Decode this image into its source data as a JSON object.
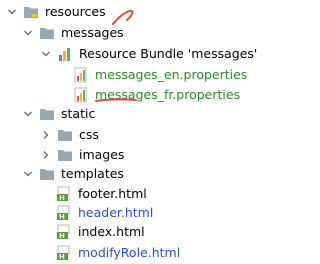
{
  "project_tree": {
    "items": [
      {
        "label": "resources",
        "icon": "folder-icon",
        "expanded": true
      },
      {
        "label": "messages",
        "icon": "folder-icon",
        "expanded": true
      },
      {
        "label": "Resource Bundle 'messages'",
        "icon": "resource-bundle-icon",
        "expanded": true
      },
      {
        "label": "messages_en.properties",
        "icon": "properties-file-icon",
        "color": "#2a8a2a"
      },
      {
        "label": "messages_fr.properties",
        "icon": "properties-file-icon",
        "color": "#2a8a2a"
      },
      {
        "label": "static",
        "icon": "folder-icon",
        "expanded": true
      },
      {
        "label": "css",
        "icon": "folder-icon",
        "expanded": false
      },
      {
        "label": "images",
        "icon": "folder-icon",
        "expanded": false
      },
      {
        "label": "templates",
        "icon": "folder-icon",
        "expanded": true
      },
      {
        "label": "footer.html",
        "icon": "html-file-icon"
      },
      {
        "label": "header.html",
        "icon": "html-file-icon",
        "color": "#2f4fbf"
      },
      {
        "label": "index.html",
        "icon": "html-file-icon"
      },
      {
        "label": "modifyRole.html",
        "icon": "html-file-icon",
        "color": "#2f4fbf"
      }
    ]
  },
  "colors": {
    "folder": "#9aa7b0",
    "new_file_text": "#2a8a2a",
    "modified_file_text": "#2f4fbf",
    "annotation": "#e34a4a"
  }
}
